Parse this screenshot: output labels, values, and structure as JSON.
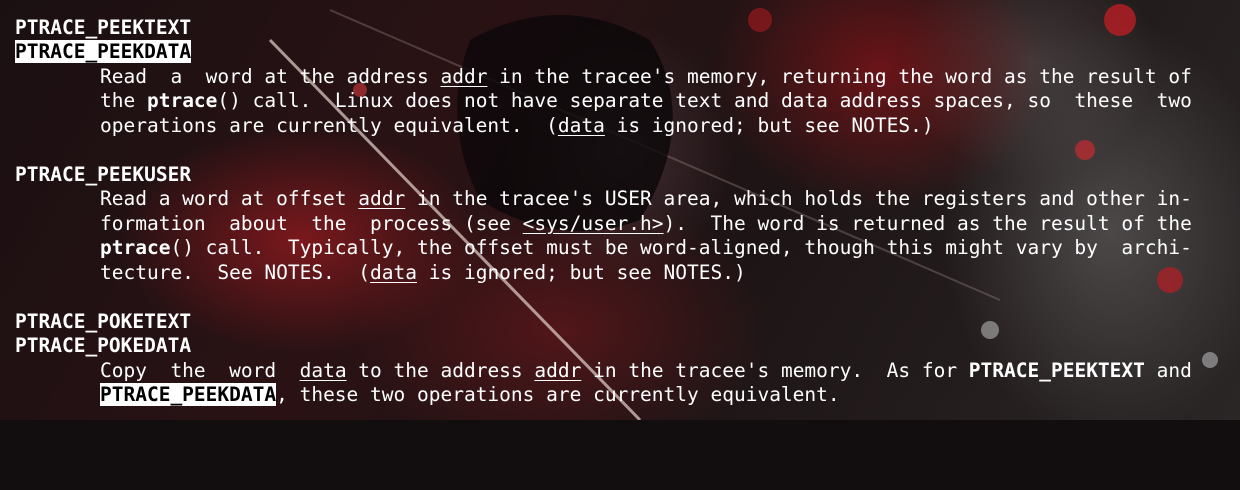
{
  "manpage": {
    "peek_text": {
      "name": "PTRACE_PEEKTEXT",
      "name2": "PTRACE_PEEKDATA",
      "l1a": "Read  a  word at the address ",
      "l1b": "addr",
      "l1c": " in the tracee's memory, returning the word as the result of",
      "l2a": "the ",
      "l2b": "ptrace",
      "l2c": "() call.  Linux does not have separate text and data address spaces, so  these  two",
      "l3a": "operations are currently equivalent.  (",
      "l3b": "data",
      "l3c": " is ignored; but see NOTES.)"
    },
    "peek_user": {
      "name": "PTRACE_PEEKUSER",
      "l1a": "Read a word at offset ",
      "l1b": "addr",
      "l1c": " in the tracee's USER area, which holds the registers and other in-",
      "l2a": "formation  about  the  process (see ",
      "l2b": "<sys/user.h>",
      "l2c": ").  The word is returned as the result of the",
      "l3a": "ptrace",
      "l3b": "() call.  Typically, the offset must be word-aligned, though this might vary by  archi-",
      "l4a": "tecture.  See NOTES.  (",
      "l4b": "data",
      "l4c": " is ignored; but see NOTES.)"
    },
    "poke_text": {
      "name": "PTRACE_POKETEXT",
      "name2": "PTRACE_POKEDATA",
      "l1a": "Copy  the  word  ",
      "l1b": "data",
      "l1c": " to the address ",
      "l1d": "addr",
      "l1e": " in the tracee's memory.  As for ",
      "l1f": "PTRACE_PEEKTEXT",
      "l1g": " and",
      "l2a": "PTRACE_PEEKDATA",
      "l2b": ", these two operations are currently equivalent."
    }
  },
  "colors": {
    "text": "#ffffff",
    "highlight_bg": "#ffffff",
    "highlight_text": "#000000",
    "wallpaper_red": "#b81e24"
  }
}
